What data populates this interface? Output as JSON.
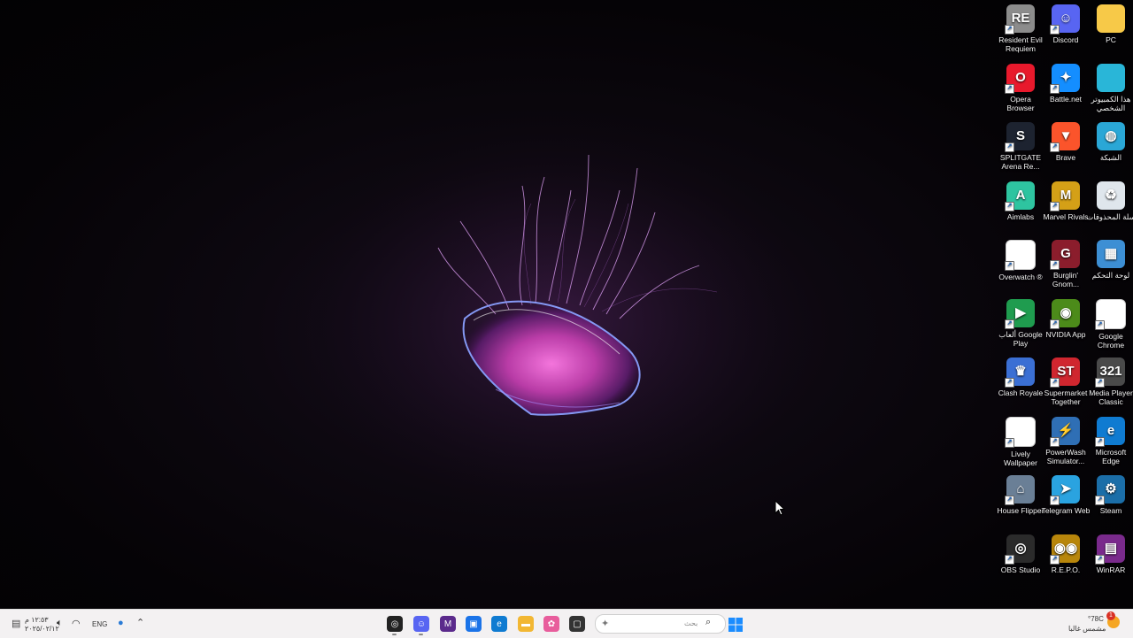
{
  "desktop": {
    "icons": [
      {
        "label": "Resident Evil Requiem",
        "icon": "resident-evil-icon",
        "color": "#8c8c8c",
        "glyph": "RE"
      },
      {
        "label": "Discord",
        "icon": "discord-icon",
        "color": "#5865f2",
        "glyph": "☺"
      },
      {
        "label": "PC",
        "icon": "folder-icon",
        "color": "#f7c948",
        "glyph": ""
      },
      {
        "label": "Opera Browser",
        "icon": "opera-icon",
        "color": "#e8192c",
        "glyph": "O"
      },
      {
        "label": "Battle.net",
        "icon": "battlenet-icon",
        "color": "#148eff",
        "glyph": "✦"
      },
      {
        "label": "هذا الكمبيوتر الشخصي",
        "icon": "monitor-icon",
        "color": "#29b6d8",
        "glyph": ""
      },
      {
        "label": "SPLITGATE Arena Re...",
        "icon": "splitgate-icon",
        "color": "#1d2330",
        "glyph": "S"
      },
      {
        "label": "Brave",
        "icon": "brave-icon",
        "color": "#fb542b",
        "glyph": "▼"
      },
      {
        "label": "الشبكة",
        "icon": "network-icon",
        "color": "#2aa7d6",
        "glyph": "◍"
      },
      {
        "label": "Aimlabs",
        "icon": "aimlabs-icon",
        "color": "#2ec4a0",
        "glyph": "A"
      },
      {
        "label": "Marvel Rivals",
        "icon": "marvel-rivals-icon",
        "color": "#d4a017",
        "glyph": "M"
      },
      {
        "label": "سلة المحذوفات",
        "icon": "recycle-bin-icon",
        "color": "#dfe6ec",
        "glyph": "♻"
      },
      {
        "label": "Overwatch ®",
        "icon": "document-icon",
        "color": "#ffffff",
        "glyph": ""
      },
      {
        "label": "Burglin' Gnom...",
        "icon": "burglin-gnomes-icon",
        "color": "#8b1d2c",
        "glyph": "G"
      },
      {
        "label": "لوحة التحكم",
        "icon": "control-panel-icon",
        "color": "#3d8fd4",
        "glyph": "▦"
      },
      {
        "label": "ألعاب Google Play",
        "icon": "google-play-games-icon",
        "color": "#1f9c4f",
        "glyph": "▶"
      },
      {
        "label": "NVIDIA App",
        "icon": "nvidia-icon",
        "color": "#4c8b1a",
        "glyph": "◉"
      },
      {
        "label": "Google Chrome",
        "icon": "chrome-icon",
        "color": "#ffffff",
        "glyph": ""
      },
      {
        "label": "Clash Royale",
        "icon": "clash-royale-icon",
        "color": "#3b6fd4",
        "glyph": "♛"
      },
      {
        "label": "Supermarket Together",
        "icon": "supermarket-together-icon",
        "color": "#d0262f",
        "glyph": "ST"
      },
      {
        "label": "Media Player Classic",
        "icon": "media-player-classic-icon",
        "color": "#4a4a4a",
        "glyph": "321"
      },
      {
        "label": "Lively Wallpaper",
        "icon": "lively-wallpaper-icon",
        "color": "#ffffff",
        "glyph": ""
      },
      {
        "label": "PowerWash Simulator...",
        "icon": "powerwash-icon",
        "color": "#2f6fb5",
        "glyph": "⚡"
      },
      {
        "label": "Microsoft Edge",
        "icon": "edge-icon",
        "color": "#0f7bd1",
        "glyph": "e"
      },
      {
        "label": "House Flipper",
        "icon": "house-flipper-icon",
        "color": "#6a7f96",
        "glyph": "⌂"
      },
      {
        "label": "Telegram Web",
        "icon": "telegram-icon",
        "color": "#2aa3e0",
        "glyph": "➤"
      },
      {
        "label": "Steam",
        "icon": "steam-icon",
        "color": "#1b6ea8",
        "glyph": "⚙"
      },
      {
        "label": "OBS Studio",
        "icon": "obs-icon",
        "color": "#2b2b2b",
        "glyph": "◎"
      },
      {
        "label": "R.E.P.O.",
        "icon": "repo-icon",
        "color": "#b8860b",
        "glyph": "◉◉"
      },
      {
        "label": "WinRAR",
        "icon": "winrar-icon",
        "color": "#7a2a8c",
        "glyph": "▤"
      }
    ]
  },
  "taskbar": {
    "weather_temp": "°78C",
    "weather_desc": "مشمس غالبا",
    "search_placeholder": "بحث",
    "notification_count": "1",
    "language": "ENG",
    "clock_time": "١٢:٥٣ م",
    "clock_date": "٢٠٢٥/٠٢/١٢",
    "apps": [
      {
        "name": "obs-taskbar-icon",
        "color": "#222222",
        "glyph": "◎"
      },
      {
        "name": "discord-taskbar-icon",
        "color": "#5865f2",
        "glyph": "☺"
      },
      {
        "name": "marvel-rivals-taskbar-icon",
        "color": "#5b2a8c",
        "glyph": "M"
      },
      {
        "name": "store-taskbar-icon",
        "color": "#1a73e8",
        "glyph": "▣"
      },
      {
        "name": "edge-taskbar-icon",
        "color": "#0f7bd1",
        "glyph": "e"
      },
      {
        "name": "file-explorer-taskbar-icon",
        "color": "#f2b733",
        "glyph": "▬"
      },
      {
        "name": "copilot-taskbar-icon",
        "color": "#e85d9c",
        "glyph": "✿"
      },
      {
        "name": "task-view-taskbar-icon",
        "color": "#333333",
        "glyph": "▢"
      }
    ]
  }
}
